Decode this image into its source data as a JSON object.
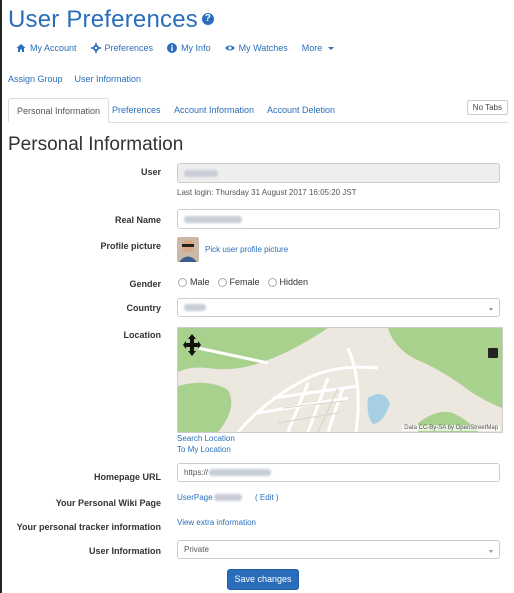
{
  "page": {
    "title": "User Preferences"
  },
  "nav": [
    {
      "label": "My Account",
      "icon": "home-icon"
    },
    {
      "label": "Preferences",
      "icon": "gear-icon"
    },
    {
      "label": "My Info",
      "icon": "info-icon"
    },
    {
      "label": "My Watches",
      "icon": "eye-icon"
    },
    {
      "label": "More",
      "icon": "chevron-down-icon"
    }
  ],
  "subnav": [
    "Assign Group",
    "User Information"
  ],
  "tabs": [
    "Personal Information",
    "Preferences",
    "Account Information",
    "Account Deletion"
  ],
  "no_tabs_label": "No Tabs",
  "section_title": "Personal Information",
  "form": {
    "user_label": "User",
    "last_login": "Last login: Thursday 31 August 2017 16:05:20 JST",
    "real_name_label": "Real Name",
    "profile_picture_label": "Profile picture",
    "pick_picture": "Pick user profile picture",
    "gender_label": "Gender",
    "gender_options": [
      "Male",
      "Female",
      "Hidden"
    ],
    "country_label": "Country",
    "location_label": "Location",
    "map_attribution": "Data CC-By-SA by OpenStreetMap",
    "search_location": "Search Location",
    "to_my_location": "To My Location",
    "homepage_label": "Homepage URL",
    "homepage_value": "https://",
    "wiki_label": "Your Personal Wiki Page",
    "wiki_link": "UserPage",
    "wiki_edit": "( Edit )",
    "tracker_label": "Your personal tracker information",
    "tracker_link": "View extra information",
    "userinfo_label": "User Information",
    "userinfo_value": "Private",
    "save": "Save changes"
  },
  "colors": {
    "accent": "#2a6ebb",
    "map_green": "#a9d18e",
    "map_water": "#a7cfe3"
  }
}
